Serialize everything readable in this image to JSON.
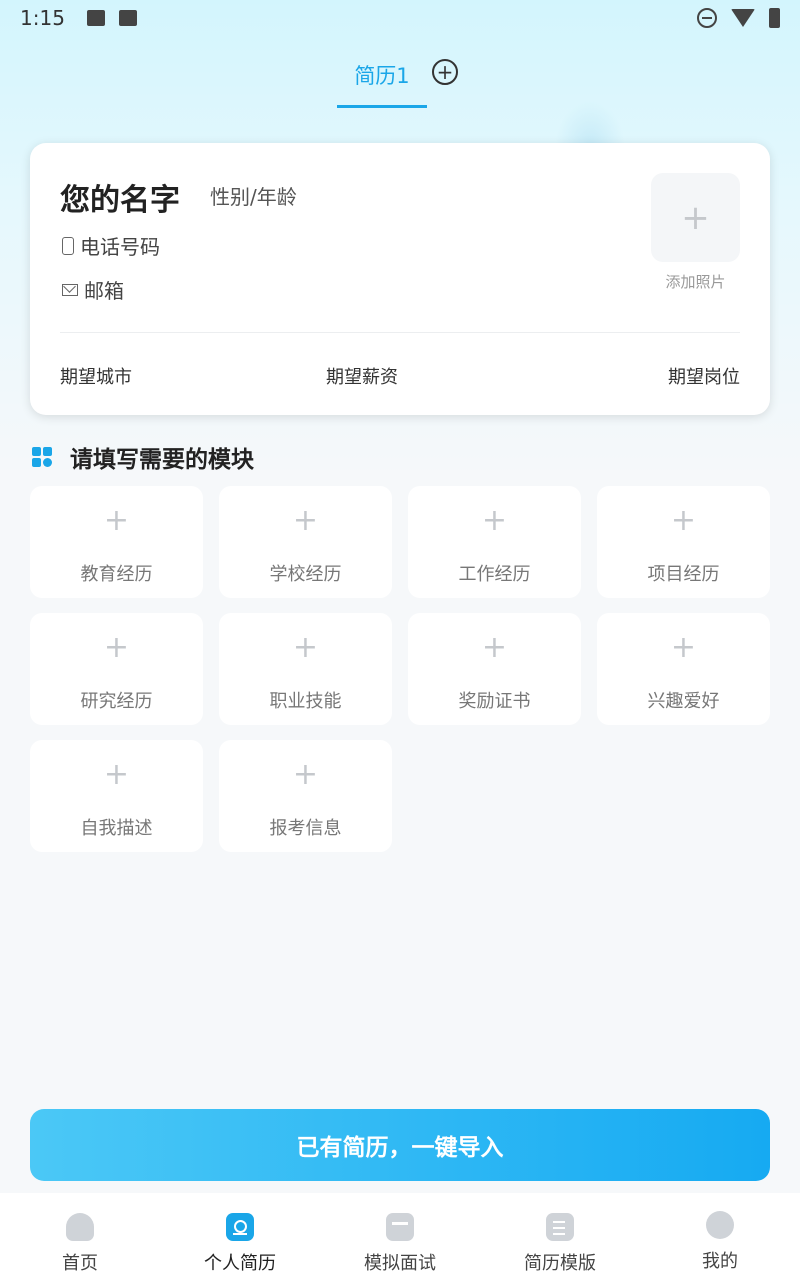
{
  "status_bar": {
    "time": "1:15"
  },
  "tabs": {
    "active_label": "简历1",
    "add_symbol": "+"
  },
  "profile": {
    "name": "您的名字",
    "gender_age": "性别/年龄",
    "phone": "电话号码",
    "email": "邮箱",
    "photo_plus": "+",
    "photo_label": "添加照片",
    "expect_city": "期望城市",
    "expect_salary": "期望薪资",
    "expect_position": "期望岗位"
  },
  "section": {
    "title": "请填写需要的模块"
  },
  "modules": [
    {
      "plus": "+",
      "label": "教育经历"
    },
    {
      "plus": "+",
      "label": "学校经历"
    },
    {
      "plus": "+",
      "label": "工作经历"
    },
    {
      "plus": "+",
      "label": "项目经历"
    },
    {
      "plus": "+",
      "label": "研究经历"
    },
    {
      "plus": "+",
      "label": "职业技能"
    },
    {
      "plus": "+",
      "label": "奖励证书"
    },
    {
      "plus": "+",
      "label": "兴趣爱好"
    },
    {
      "plus": "+",
      "label": "自我描述"
    },
    {
      "plus": "+",
      "label": "报考信息"
    }
  ],
  "import_button": {
    "label": "已有简历，一键导入"
  },
  "bottom_nav": [
    {
      "label": "首页",
      "icon": "home-icon"
    },
    {
      "label": "个人简历",
      "icon": "resume-icon"
    },
    {
      "label": "模拟面试",
      "icon": "interview-icon"
    },
    {
      "label": "简历模版",
      "icon": "template-icon"
    },
    {
      "label": "我的",
      "icon": "profile-icon"
    }
  ],
  "colors": {
    "accent": "#1aa6e8",
    "button_start": "#4bc8f6",
    "button_end": "#16aaf2"
  }
}
